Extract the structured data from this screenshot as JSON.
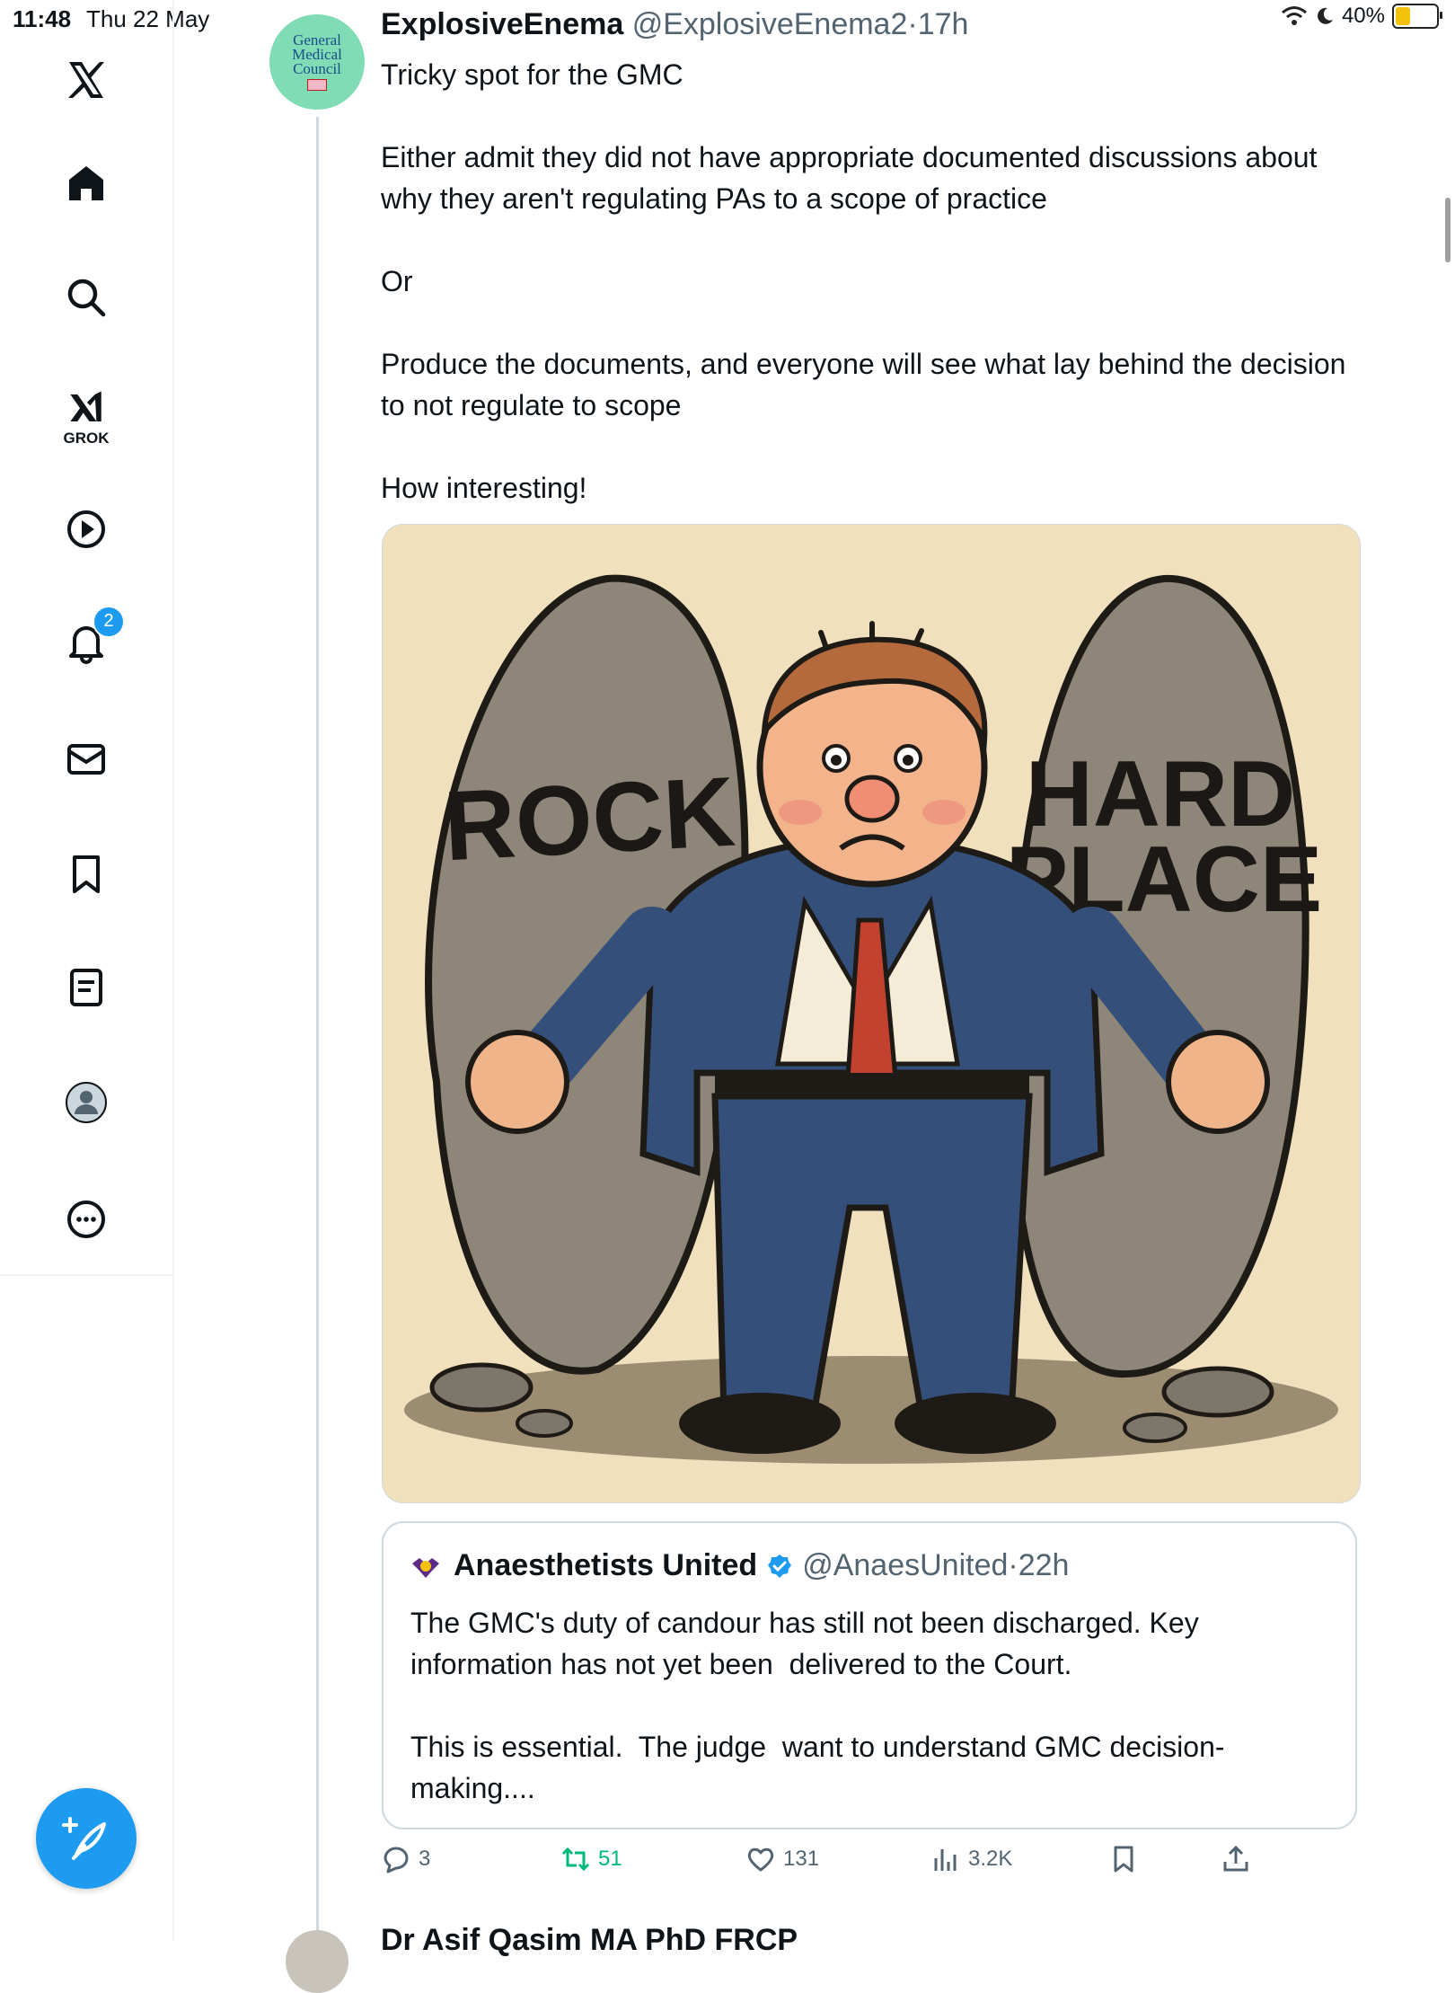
{
  "status_bar": {
    "time": "11:48",
    "date": "Thu 22 May",
    "battery": "40%",
    "battery_level": 0.4
  },
  "sidebar": {
    "notifications_badge": "2",
    "grok_label": "GROK"
  },
  "tweet": {
    "author_name": "ExplosiveEnema",
    "author_handle": "@ExplosiveEnema2",
    "separator": "·",
    "time": "17h",
    "avatar_text": "General Medical Council",
    "text": "Tricky spot for the GMC\n\nEither admit they did not have appropriate documented discussions about why they aren't regulating PAs to a scope of practice\n\nOr\n\nProduce the documents, and everyone will see what lay behind the decision to not regulate to scope\n\nHow interesting!",
    "image": {
      "left_rock_label": "ROCK",
      "right_rock_label_1": "HARD",
      "right_rock_label_2": "PLACE"
    },
    "quote": {
      "author_name": "Anaesthetists United",
      "author_handle": "@AnaesUnited",
      "separator": "·",
      "time": "22h",
      "text": "The GMC's duty of candour has still not been discharged. Key information has not yet been  delivered to the Court.\n\nThis is essential.  The judge  want to understand GMC decision-making...."
    },
    "actions": {
      "replies": "3",
      "reposts": "51",
      "likes": "131",
      "views": "3.2K"
    }
  },
  "next_tweet": {
    "author_partial": "Dr Asif Qasim MA PhD FRCP"
  },
  "colors": {
    "accent": "#1d9bf0",
    "repost_green": "#00ba7c",
    "muted": "#536471"
  }
}
